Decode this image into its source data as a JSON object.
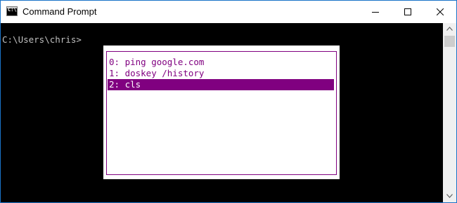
{
  "window": {
    "title": "Command Prompt",
    "app_icon_text": "C:\\",
    "app_icon": "console-icon",
    "controls": [
      "minimize-icon",
      "maximize-icon",
      "close-icon"
    ]
  },
  "console": {
    "prompt": "C:\\Users\\chris>",
    "background": "#000000",
    "text_color": "#c0c0c0"
  },
  "history_popup": {
    "items": [
      {
        "label": "0: ping google.com",
        "selected": false
      },
      {
        "label": "1: doskey /history",
        "selected": false
      },
      {
        "label": "2: cls",
        "selected": true
      }
    ],
    "accent_color": "#800080",
    "background": "#ffffff"
  },
  "scrollbar": {
    "up_icon": "scroll-up-arrow-icon",
    "down_icon": "scroll-down-arrow-icon"
  }
}
